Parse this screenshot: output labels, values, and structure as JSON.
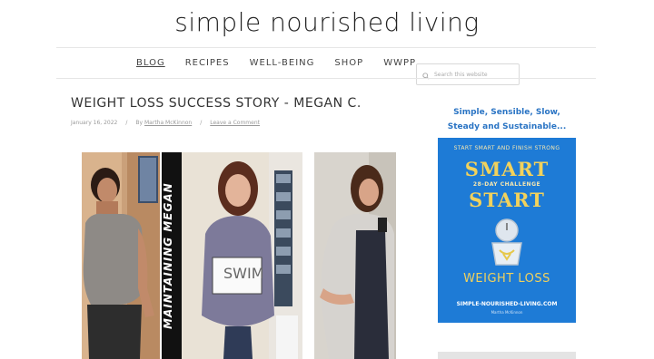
{
  "site": {
    "title": "simple nourished living"
  },
  "nav": {
    "items": [
      {
        "label": "BLOG"
      },
      {
        "label": "RECIPES"
      },
      {
        "label": "WELL-BEING"
      },
      {
        "label": "SHOP"
      },
      {
        "label": "WWPP"
      }
    ]
  },
  "search": {
    "placeholder": "Search this website"
  },
  "post": {
    "title": "WEIGHT LOSS SUCCESS STORY - MEGAN C.",
    "date": "January 16, 2022",
    "separator": "/",
    "by": "By",
    "author": "Martha McKinnon",
    "comment_link": "Leave a Comment",
    "photos": [
      {
        "caption": ""
      },
      {
        "caption": "MAINTAINING MEGAN",
        "sign": "SWIM"
      },
      {
        "caption": ""
      }
    ]
  },
  "sidebar": {
    "tagline_line1": "Simple, Sensible, Slow,",
    "tagline_line2": "Steady and Sustainable...",
    "ad": {
      "kicker": "START SMART AND FINISH STRONG",
      "word1": "SMART",
      "subtitle": "28-DAY CHALLENGE",
      "word2": "START",
      "label": "WEIGHT LOSS",
      "url": "SIMPLE-NOURISHED-LIVING.COM",
      "author": "Martha McKinnon",
      "background": "#1e7bd6",
      "accent": "#f2d25c"
    }
  },
  "colors": {
    "title_link": "#2a74c4",
    "divider": "#e6e6e6"
  }
}
